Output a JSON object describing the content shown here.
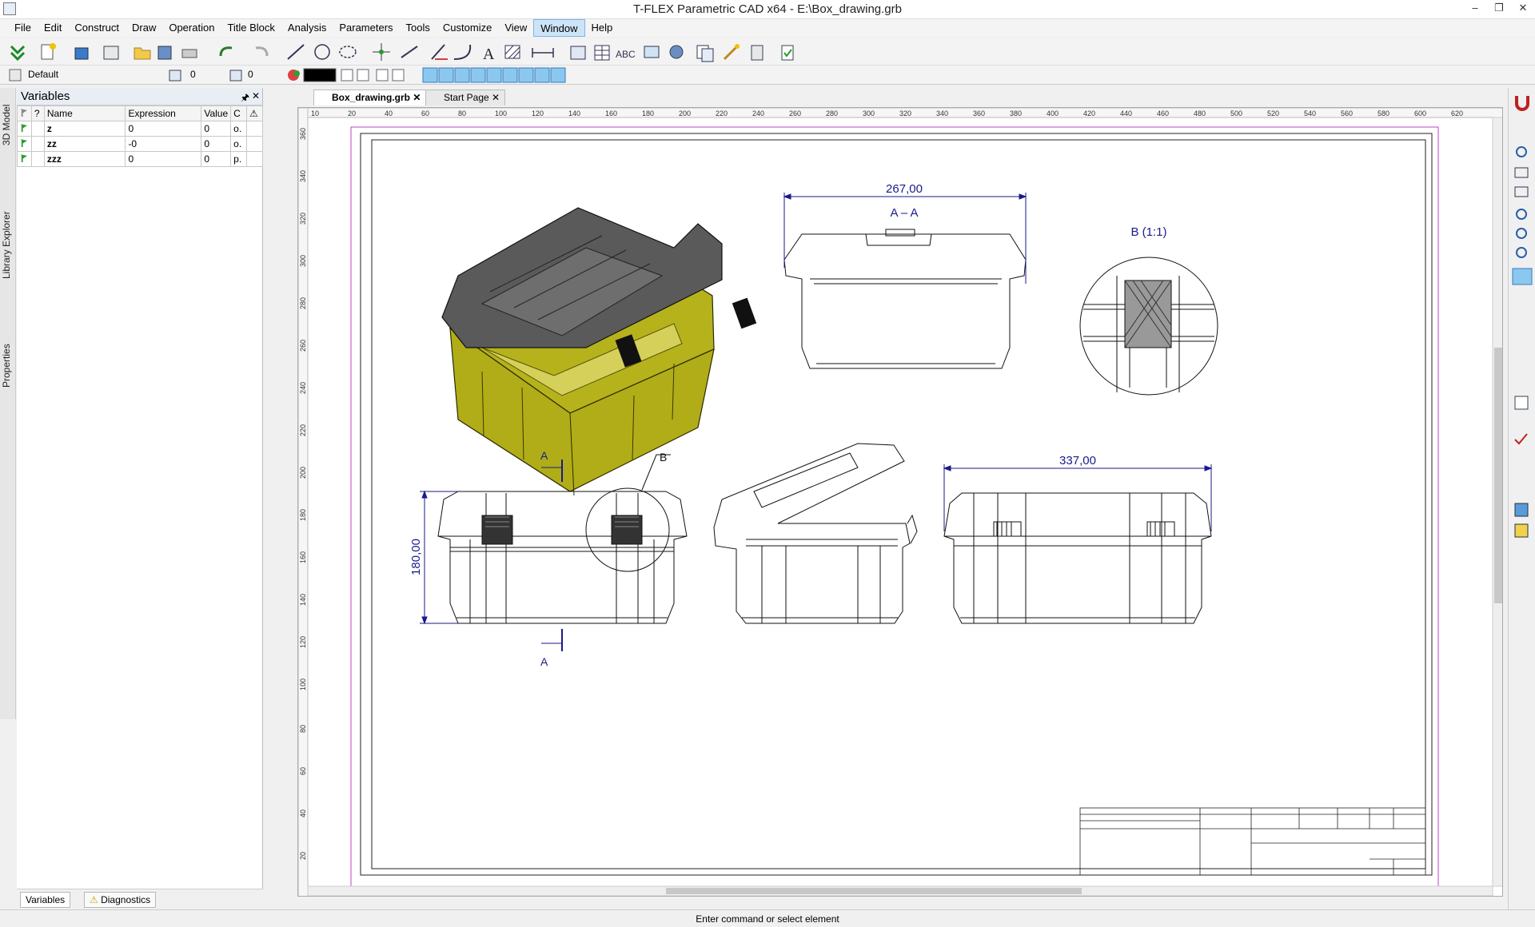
{
  "window": {
    "title": "T-FLEX Parametric CAD x64 - E:\\Box_drawing.grb",
    "minimize": "–",
    "restore": "❐",
    "close": "✕"
  },
  "menu": [
    "File",
    "Edit",
    "Construct",
    "Draw",
    "Operation",
    "Title Block",
    "Analysis",
    "Parameters",
    "Tools",
    "Customize",
    "View",
    "Window",
    "Help"
  ],
  "toolbar2": {
    "layer": "Default",
    "value1": "0",
    "value2": "0"
  },
  "side_tabs": [
    "3D Model",
    "Library Explorer",
    "Properties"
  ],
  "variables_panel": {
    "title": "Variables",
    "pin": "🖈",
    "close": "✕",
    "columns": [
      "?",
      "Name",
      "Expression",
      "Value",
      "C"
    ],
    "rows": [
      {
        "name": "z",
        "expression": "0",
        "value": "0",
        "c": "o."
      },
      {
        "name": "zz",
        "expression": "-0",
        "value": "0",
        "c": "o."
      },
      {
        "name": "zzz",
        "expression": "0",
        "value": "0",
        "p": "p."
      }
    ],
    "tabs": [
      "Variables",
      "Diagnostics"
    ]
  },
  "doc_tabs": [
    "Box_drawing.grb",
    "Start Page"
  ],
  "ruler_labels": [
    "10",
    "20",
    "40",
    "60",
    "80",
    "100",
    "120",
    "140",
    "160",
    "180",
    "200",
    "220",
    "240",
    "260",
    "280",
    "300",
    "320",
    "340",
    "360",
    "380",
    "400",
    "420",
    "440",
    "460",
    "480",
    "500",
    "520",
    "540",
    "560",
    "580",
    "600",
    "620"
  ],
  "vruler_labels": [
    "360",
    "340",
    "320",
    "300",
    "280",
    "260",
    "240",
    "220",
    "200",
    "180",
    "160",
    "140",
    "120",
    "100",
    "80",
    "60",
    "40",
    "20"
  ],
  "drawing": {
    "dim_top": "267,00",
    "section_title": "A – A",
    "detail_title": "B (1:1)",
    "dim_right": "337,00",
    "dim_left": "180,00",
    "label_A_top": "A",
    "label_A_bottom": "A",
    "label_B": "B"
  },
  "colors": {
    "box_body": "#b5b21c",
    "lid": "#5a5a5a",
    "dim": "#1a1a8a",
    "frame_magenta": "#c040c0"
  },
  "status": "Enter command or select element"
}
